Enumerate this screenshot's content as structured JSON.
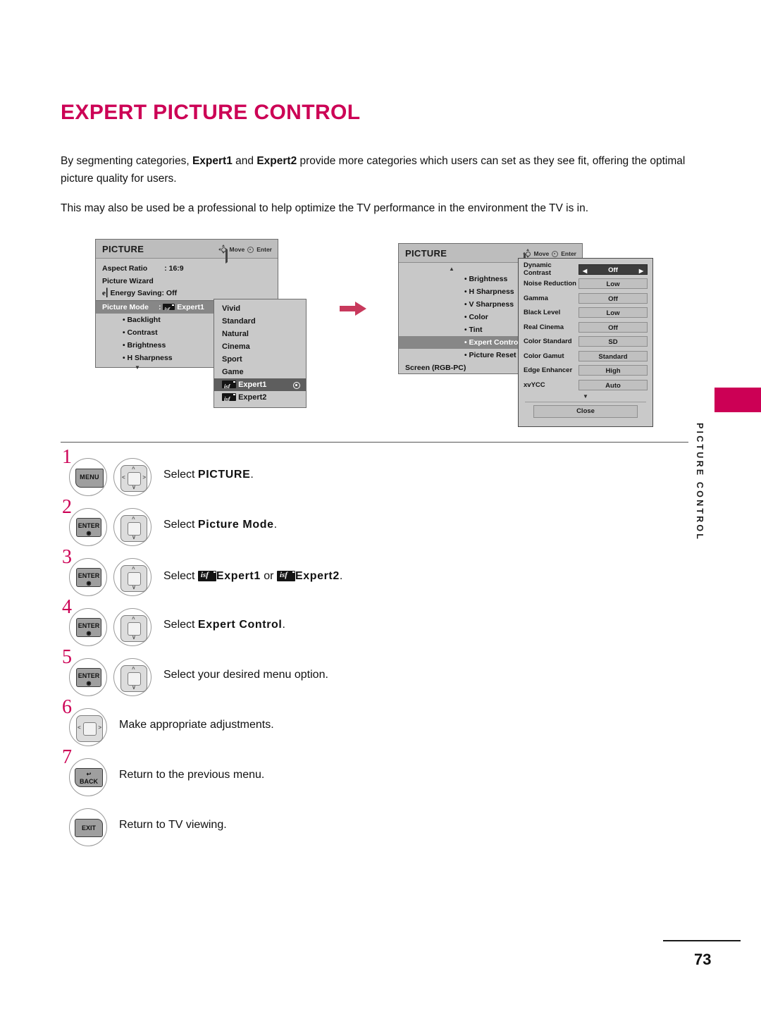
{
  "page": {
    "title": "EXPERT PICTURE CONTROL",
    "intro_line1_a": "By segmenting categories, ",
    "intro_bold1": "Expert1",
    "intro_line1_b": " and ",
    "intro_bold2": "Expert2",
    "intro_line1_c": " provide more categories which users can set as they see fit, offering the optimal picture quality for users.",
    "intro_line2": "This may also be used be a professional to help optimize the TV performance in the environment the TV is in.",
    "side_label": "PICTURE CONTROL",
    "page_number": "73",
    "accent_color": "#CC0055"
  },
  "osd_menu_1": {
    "header_title": "PICTURE",
    "hint_move": "Move",
    "hint_enter": "Enter",
    "rows": [
      {
        "label": "Aspect Ratio",
        "value": ": 16:9"
      },
      {
        "label": "Picture Wizard",
        "value": ""
      },
      {
        "label": "Energy Saving: Off",
        "value": ""
      }
    ],
    "picture_mode_label": "Picture Mode",
    "picture_mode_colon": ":",
    "picture_mode_value": "Expert1",
    "sub_items": [
      "Backlight",
      "Contrast",
      "Brightness",
      "H Sharpness"
    ],
    "more_caret": "▼"
  },
  "dropdown": {
    "options": [
      "Vivid",
      "Standard",
      "Natural",
      "Cinema",
      "Sport",
      "Game"
    ],
    "expert1": "Expert1",
    "expert2": "Expert2",
    "selected": "Expert1"
  },
  "osd_menu_2": {
    "header_title": "PICTURE",
    "hint_move": "Move",
    "hint_enter": "Enter",
    "up_caret": "▲",
    "items": [
      "Brightness",
      "H Sharpness",
      "V Sharpness",
      "Color",
      "Tint",
      "Expert Contro",
      "Picture Reset"
    ],
    "selected_item": "Expert Contro",
    "footer_item": "Screen (RGB-PC)"
  },
  "expert_control": {
    "rows": [
      {
        "label": "Dynamic Contrast",
        "value": "Off",
        "selected": true
      },
      {
        "label": "Noise Reduction",
        "value": "Low",
        "selected": false
      },
      {
        "label": "Gamma",
        "value": "Off",
        "selected": false
      },
      {
        "label": "Black Level",
        "value": "Low",
        "selected": false
      },
      {
        "label": "Real Cinema",
        "value": "Off",
        "selected": false
      },
      {
        "label": "Color Standard",
        "value": "SD",
        "selected": false
      },
      {
        "label": "Color Gamut",
        "value": "Standard",
        "selected": false
      },
      {
        "label": "Edge Enhancer",
        "value": "High",
        "selected": false
      },
      {
        "label": "xvYCC",
        "value": "Auto",
        "selected": false
      }
    ],
    "left_arrow": "◀",
    "right_arrow": "▶",
    "down_caret": "▼",
    "close_label": "Close"
  },
  "steps": [
    {
      "number": "1",
      "keys": [
        "MENU",
        "nav-4way"
      ],
      "text_plain": "Select ",
      "text_bold": "PICTURE",
      "text_tail": "."
    },
    {
      "number": "2",
      "keys": [
        "ENTER",
        "nav-updown"
      ],
      "text_plain": "Select ",
      "text_bold": "Picture Mode",
      "text_tail": "."
    },
    {
      "number": "3",
      "keys": [
        "ENTER",
        "nav-updown"
      ],
      "text_plain": "Select ",
      "text_bold": "Expert1",
      "text_mid": " or ",
      "text_bold2": "Expert2",
      "text_tail": "."
    },
    {
      "number": "4",
      "keys": [
        "ENTER",
        "nav-updown"
      ],
      "text_plain": "Select ",
      "text_bold": "Expert Control",
      "text_tail": "."
    },
    {
      "number": "5",
      "keys": [
        "ENTER",
        "nav-updown"
      ],
      "text_plain": "Select your desired menu option.",
      "text_bold": "",
      "text_tail": ""
    },
    {
      "number": "6",
      "keys": [
        "nav-leftright"
      ],
      "text_plain": "Make appropriate adjustments.",
      "text_bold": "",
      "text_tail": ""
    },
    {
      "number": "7",
      "keys": [
        "BACK"
      ],
      "text_plain": "Return to the previous menu.",
      "text_bold": "",
      "text_tail": ""
    },
    {
      "number": "",
      "keys": [
        "EXIT"
      ],
      "text_plain": "Return to TV viewing.",
      "text_bold": "",
      "text_tail": ""
    }
  ],
  "key_labels": {
    "menu": "MENU",
    "enter": "ENTER",
    "back": "BACK",
    "exit": "EXIT"
  }
}
